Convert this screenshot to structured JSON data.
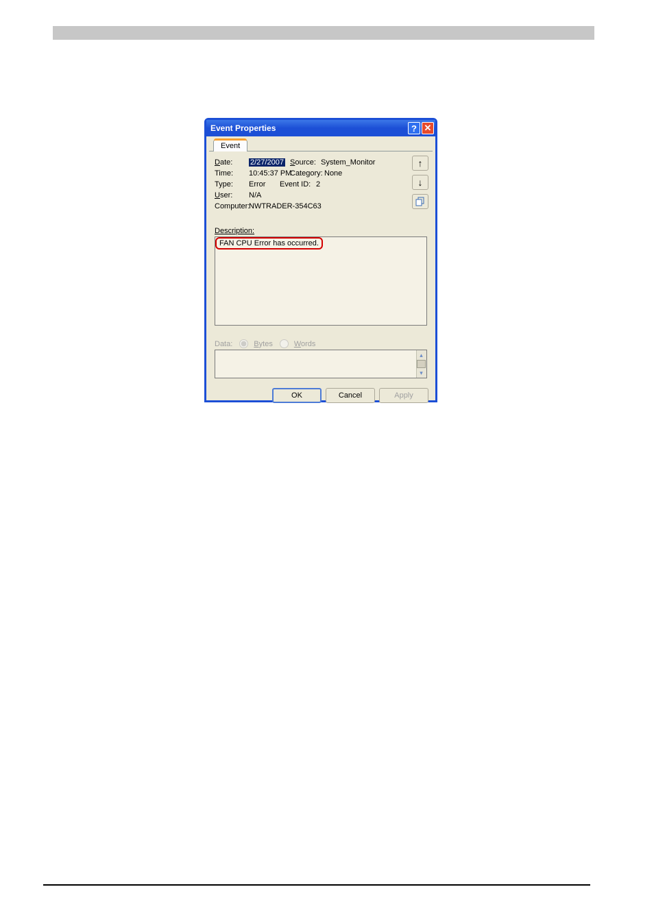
{
  "dialog": {
    "title": "Event Properties",
    "tab_label": "Event",
    "labels": {
      "date": "Date:",
      "source": "Source:",
      "time": "Time:",
      "category": "Category:",
      "type": "Type:",
      "event_id": "Event ID:",
      "user": "User:",
      "computer": "Computer:",
      "description": "Description:",
      "data": "Data:",
      "bytes": "Bytes",
      "words": "Words"
    },
    "values": {
      "date": "2/27/2007",
      "source": "System_Monitor",
      "time": "10:45:37 PM",
      "category": "None",
      "type": "Error",
      "event_id": "2",
      "user": "N/A",
      "computer": "NWTRADER-354C63",
      "description_text": "FAN CPU Error has occurred."
    },
    "buttons": {
      "ok": "OK",
      "cancel": "Cancel",
      "apply": "Apply"
    }
  }
}
